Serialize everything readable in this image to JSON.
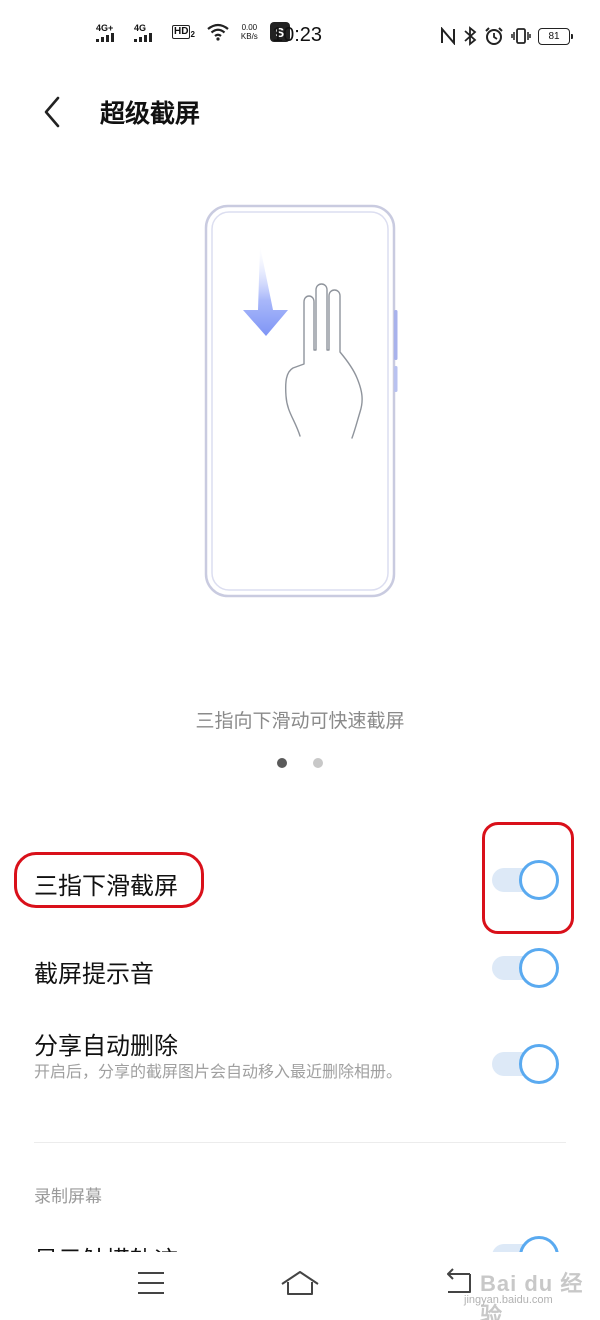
{
  "status_bar": {
    "sim1": "4G+",
    "sim2": "4G",
    "hd": "HD",
    "hd_sub": "2",
    "speed_value": "0.00",
    "speed_unit": "KB/s",
    "app_badge": "S",
    "time": "10:23",
    "battery": "81",
    "icons": [
      "nfc-icon",
      "bluetooth-icon",
      "alarm-icon",
      "vibrate-icon",
      "battery-icon"
    ]
  },
  "header": {
    "title": "超级截屏",
    "back_icon": "chevron-left-icon"
  },
  "carousel": {
    "caption": "三指向下滑动可快速截屏",
    "page_count": 2,
    "active_page": 1
  },
  "settings": {
    "three_finger": {
      "label": "三指下滑截屏",
      "enabled": true
    },
    "sound": {
      "label": "截屏提示音",
      "enabled": true
    },
    "auto_delete": {
      "label": "分享自动删除",
      "desc": "开启后，分享的截屏图片会自动移入最近删除相册。",
      "enabled": true
    },
    "record_section": "录制屏幕",
    "show_touch": {
      "label": "显示触摸轨迹",
      "enabled": true
    }
  },
  "colors": {
    "toggle_knob_border": "#5aaaf0",
    "toggle_track": "#dde9f7",
    "highlight": "#d9101a",
    "arrow": "#7f95f5"
  },
  "nav_bar": {
    "icons": [
      "menu-icon",
      "home-icon",
      "back-icon"
    ]
  },
  "watermark": {
    "text": "Bai du 经验",
    "url": "jingyan.baidu.com"
  }
}
